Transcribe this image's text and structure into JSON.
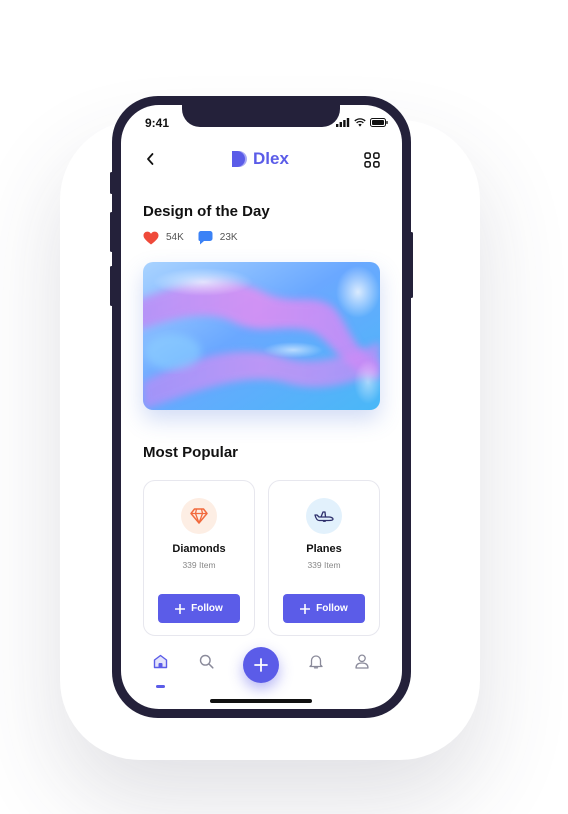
{
  "status_bar": {
    "time": "9:41"
  },
  "header": {
    "app_name": "Dlex"
  },
  "design_of_day": {
    "title": "Design of the Day",
    "likes": "54K",
    "comments": "23K"
  },
  "most_popular": {
    "title": "Most Popular",
    "cards": [
      {
        "name": "Diamonds",
        "count": "339 Item",
        "button": "Follow",
        "icon": "diamond-icon"
      },
      {
        "name": "Planes",
        "count": "339 Item",
        "button": "Follow",
        "icon": "plane-icon"
      }
    ]
  },
  "nav": {
    "items": [
      "home-icon",
      "search-icon",
      "add-icon",
      "bell-icon",
      "user-icon"
    ],
    "active": "home"
  },
  "colors": {
    "accent": "#5b5ce8",
    "frame": "#24213a",
    "like": "#ef4a3a",
    "comment": "#3b82f6",
    "diamond": "#f26a3d"
  }
}
